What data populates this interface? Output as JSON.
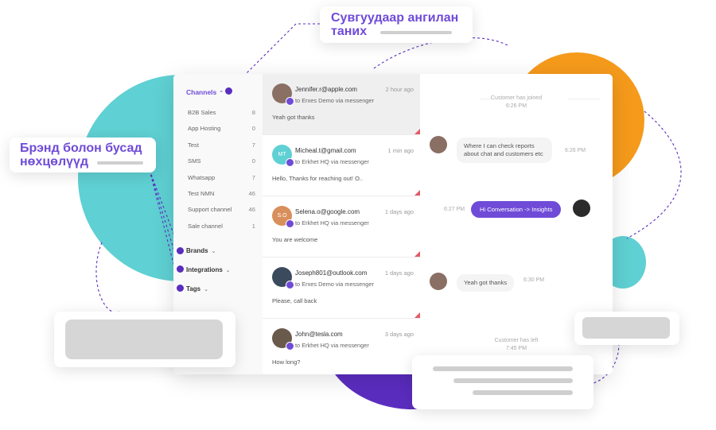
{
  "sidebar": {
    "channels_label": "Channels",
    "items": [
      {
        "label": "B2B Sales",
        "count": "8"
      },
      {
        "label": "App Hosting",
        "count": "0"
      },
      {
        "label": "Test",
        "count": "7"
      },
      {
        "label": "SMS",
        "count": "0"
      },
      {
        "label": "Whatsapp",
        "count": "7"
      },
      {
        "label": "Test NMN",
        "count": "46"
      },
      {
        "label": "Support channel",
        "count": "46"
      },
      {
        "label": "Sale channel",
        "count": "1"
      }
    ],
    "brands_label": "Brands",
    "integrations_label": "Integrations",
    "tags_label": "Tags"
  },
  "conversations": [
    {
      "email": "Jennifer.r@apple.com",
      "time": "2 hour ago",
      "via": "to Erxes Demo via messenger",
      "message": "Yeah got thanks",
      "avatar_initials": "",
      "avatar_color": "#8a6f64"
    },
    {
      "email": "Micheal.t@gmail.com",
      "time": "1 min ago",
      "via": "to Erkhet HQ via messenger",
      "message": "Hello, Thanks for reaching out! O..",
      "avatar_initials": "MT",
      "avatar_color": "#5fd0d3"
    },
    {
      "email": "Selena.o@google.com",
      "time": "1 days ago",
      "via": "to Erkhet HQ via messenger",
      "message": "You are welcome",
      "avatar_initials": "S.O",
      "avatar_color": "#d98f5b"
    },
    {
      "email": "Joseph801@outlook.com",
      "time": "1 days ago",
      "via": "to Erxes Demo via messenger",
      "message": "Please, call back",
      "avatar_initials": "",
      "avatar_color": "#3b4a5c"
    },
    {
      "email": "John@tesla.com",
      "time": "3 days ago",
      "via": "to Erkhet HQ via messenger",
      "message": "How long?",
      "avatar_initials": "",
      "avatar_color": "#6a5a4c"
    }
  ],
  "chat": {
    "joined_note": "Customer has joined",
    "joined_time": "6:26 PM",
    "msg1": "Where I can check reports about chat and customers etc",
    "msg1_time": "6:26 PM",
    "msg2": "Hi Conversation -> Insights",
    "msg2_time": "6:27 PM",
    "msg3": "Yeah got thanks",
    "msg3_time": "6:30 PM",
    "left_note": "Customer has left",
    "left_time": "7:45 PM"
  },
  "callouts": {
    "top_line1": "Сувгуудаар ангилан",
    "top_line2": "таних",
    "left_line1": "Брэнд болон бусад",
    "left_line2": "нөхцөлүүд"
  },
  "colors": {
    "accent": "#6f4bd8",
    "teal": "#5fd0d3",
    "orange": "#f59a1b",
    "deep_purple": "#5b2dbf"
  }
}
